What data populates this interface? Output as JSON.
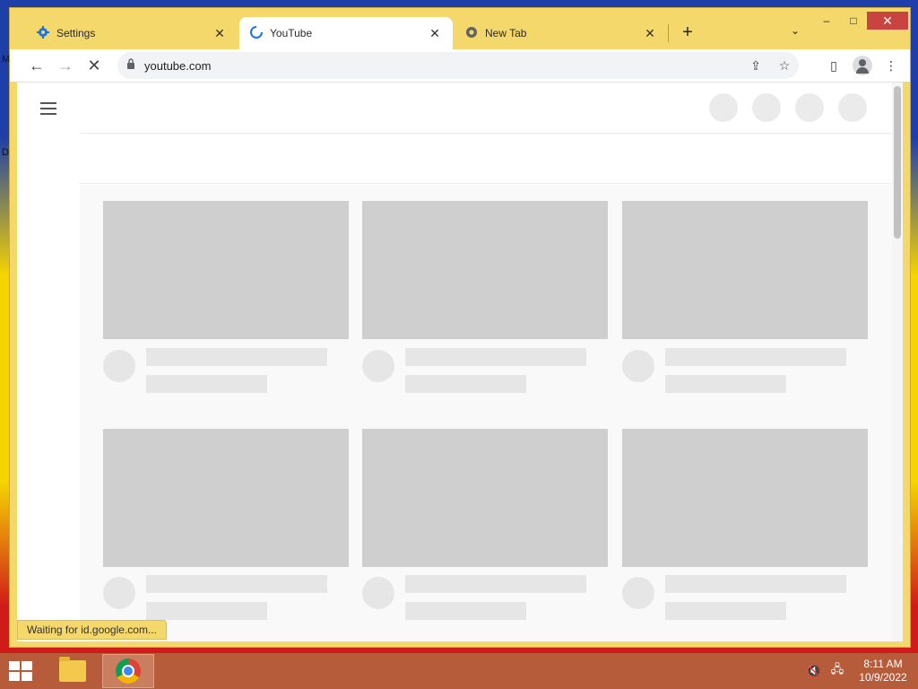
{
  "desktop": {
    "edge_letters": [
      "M",
      "D"
    ]
  },
  "browser": {
    "tabs": [
      {
        "title": "Settings",
        "icon": "gear-icon",
        "active": false
      },
      {
        "title": "YouTube",
        "icon": "loading-spinner-icon",
        "active": true
      },
      {
        "title": "New Tab",
        "icon": "chrome-icon",
        "active": false
      }
    ],
    "close_glyph": "✕",
    "new_tab_glyph": "+",
    "tab_search_glyph": "⌄",
    "window_controls": {
      "minimize": "–",
      "maximize": "□",
      "close": "✕"
    },
    "nav": {
      "back": "←",
      "forward": "→",
      "stop": "✕"
    },
    "omnibox": {
      "url": "youtube.com",
      "lock_glyph": "🔒",
      "share_glyph": "⇪",
      "star_glyph": "☆"
    },
    "toolbar": {
      "sidepanel_glyph": "▯",
      "menu_glyph": "⋮"
    },
    "status_text": "Waiting for id.google.com..."
  },
  "taskbar": {
    "apps": [
      {
        "name": "File Explorer",
        "icon": "folder-icon",
        "active": false
      },
      {
        "name": "Google Chrome",
        "icon": "chrome-icon",
        "active": true
      }
    ],
    "tray": {
      "volume_glyph": "🔇",
      "network_glyph": "🖧"
    },
    "clock": {
      "time": "8:11 AM",
      "date": "10/9/2022"
    }
  },
  "colors": {
    "accent_frame": "#f5d86b",
    "taskbar": "#b75c3a",
    "skeleton": "#cfcfcf"
  }
}
